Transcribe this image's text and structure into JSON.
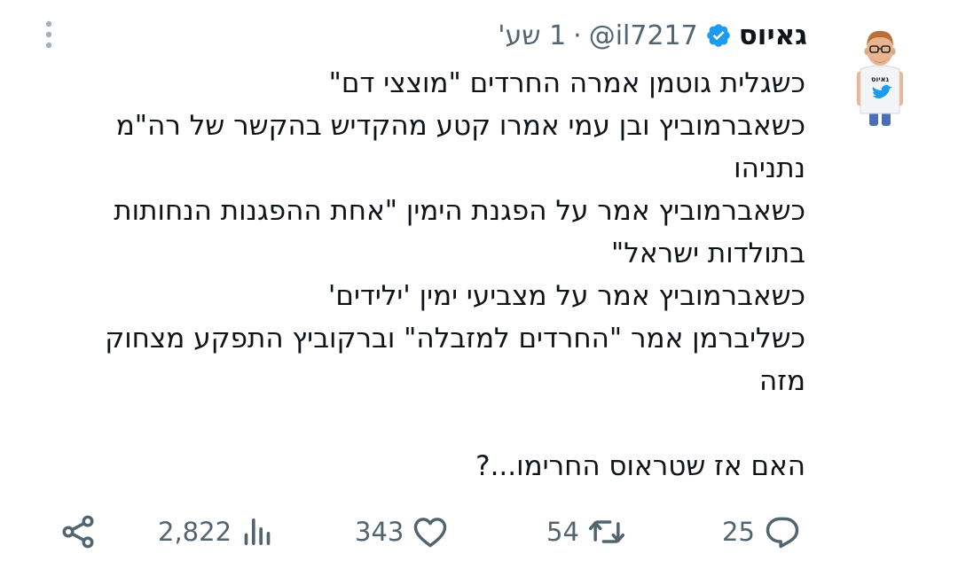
{
  "author": {
    "display_name": "גאיוס",
    "handle": "@il7217",
    "separator": "·",
    "timestamp": "1 שע'",
    "verified": true,
    "avatar_shirt_text": "גאיוס"
  },
  "tweet": {
    "lines": [
      "כשגלית גוטמן אמרה החרדים \"מוצצי דם\"",
      "כשאברמוביץ ובן עמי אמרו קטע מהקדיש בהקשר של רה\"מ",
      "נתניהו",
      "כשאברמוביץ אמר על הפגנת הימין \"אחת ההפגנות הנחותות",
      "בתולדות ישראל\"",
      "כשאברמוביץ אמר על מצביעי ימין 'ילידים'",
      "כשליברמן אמר \"החרדים למזבלה\" וברקוביץ התפקע מצחוק",
      "מזה",
      "",
      "האם אז שטראוס החרימו...?"
    ]
  },
  "actions": {
    "replies": "25",
    "retweets": "54",
    "likes": "343",
    "views": "2,822"
  },
  "colors": {
    "text": "#0f1419",
    "secondary": "#536471",
    "verified": "#1d9bf0"
  },
  "icons": [
    "reply-icon",
    "retweet-icon",
    "like-icon",
    "views-icon",
    "share-icon",
    "more-icon",
    "verified-icon"
  ]
}
